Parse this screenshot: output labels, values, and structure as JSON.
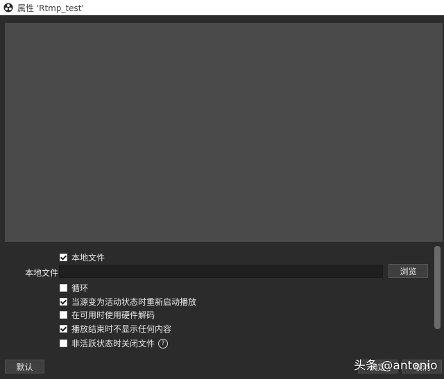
{
  "window": {
    "title": "属性 'Rtmp_test'"
  },
  "properties": {
    "local_file_checkbox": {
      "label": "本地文件",
      "checked": true
    },
    "local_file_field": {
      "label": "本地文件",
      "value": ""
    },
    "browse_label": "浏览",
    "loop": {
      "label": "循环",
      "checked": false
    },
    "restart_on_active": {
      "label": "当源变为活动状态时重新启动播放",
      "checked": true
    },
    "hw_decode": {
      "label": "在可用时使用硬件解码",
      "checked": false
    },
    "hide_on_end": {
      "label": "播放结束时不显示任何内容",
      "checked": true
    },
    "close_when_inactive": {
      "label": "非活跃状态时关闭文件",
      "checked": false
    }
  },
  "footer": {
    "defaults_label": "默认",
    "ok_label": "确定",
    "cancel_label": "取消"
  },
  "watermark": "头条 @antonio"
}
